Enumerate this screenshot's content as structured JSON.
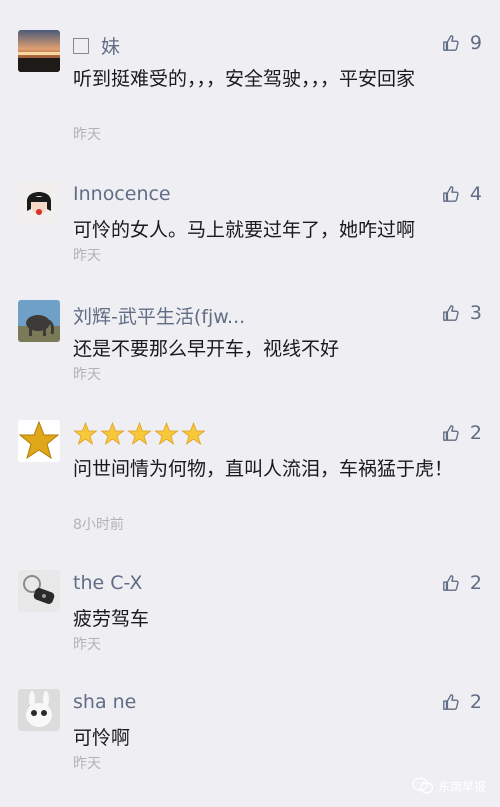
{
  "comments": [
    {
      "nick": "妹",
      "likes": "9",
      "content": "听到挺难受的，，，安全驾驶，，，平安回家",
      "time": "昨天",
      "avatar": "sunset-avatar"
    },
    {
      "nick": "Innocence",
      "likes": "4",
      "content": "可怜的女人。马上就要过年了，她咋过啊",
      "time": "昨天",
      "avatar": "girl-avatar"
    },
    {
      "nick": "刘辉-武平生活(fjw...",
      "likes": "3",
      "content": "还是不要那么早开车，视线不好",
      "time": "昨天",
      "avatar": "elephant-avatar"
    },
    {
      "nick": "",
      "likes": "2",
      "content": "问世间情为何物，直叫人流泪，车祸猛于虎！",
      "time": "8小时前",
      "avatar": "star-avatar"
    },
    {
      "nick": "the C-X",
      "likes": "2",
      "content": "疲劳驾车",
      "time": "昨天",
      "avatar": "car-key-avatar"
    },
    {
      "nick": "sha ne",
      "likes": "2",
      "content": "可怜啊",
      "time": "昨天",
      "avatar": "rabbit-avatar"
    }
  ],
  "watermark": "东南早报",
  "colors": {
    "background": "#efeef3",
    "nickname": "#616d85",
    "time": "#b4b4b4"
  },
  "icons": {
    "like": "thumbs-up-icon",
    "wechat": "wechat-logo-icon"
  }
}
